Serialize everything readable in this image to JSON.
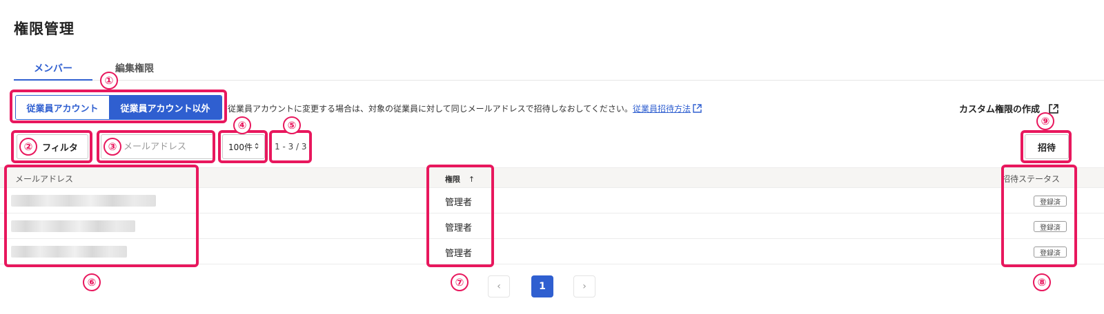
{
  "page_title": "権限管理",
  "tabs": [
    {
      "label": "メンバー",
      "active": true
    },
    {
      "label": "編集権限",
      "active": false
    }
  ],
  "account_toggle": {
    "options": [
      "従業員アカウント",
      "従業員アカウント以外"
    ],
    "selected": "従業員アカウント以外"
  },
  "notice": {
    "text": "従業員アカウントに変更する場合は、対象の従業員に対して同じメールアドレスで招待しなおしてください。",
    "link": "従業員招待方法"
  },
  "custom_permission_link": "カスタム権限の作成",
  "toolbar": {
    "filter_label": "フィルタ",
    "search_placeholder": "メールアドレス",
    "per_page": "100件",
    "range": "1 - 3 / 3",
    "invite_label": "招待"
  },
  "table": {
    "columns": [
      "メールアドレス",
      "権限",
      "招待ステータス"
    ],
    "sort_indicator": "↑",
    "rows": [
      {
        "email": "",
        "role": "管理者",
        "status": "登録済"
      },
      {
        "email": "",
        "role": "管理者",
        "status": "登録済"
      },
      {
        "email": "",
        "role": "管理者",
        "status": "登録済"
      }
    ]
  },
  "pagination": {
    "prev": "‹",
    "current": "1",
    "next": "›"
  },
  "annotations": [
    "①",
    "②",
    "③",
    "④",
    "⑤",
    "⑥",
    "⑦",
    "⑧",
    "⑨"
  ],
  "colors": {
    "accent": "#2f5fd0",
    "callout": "#e8175d"
  }
}
